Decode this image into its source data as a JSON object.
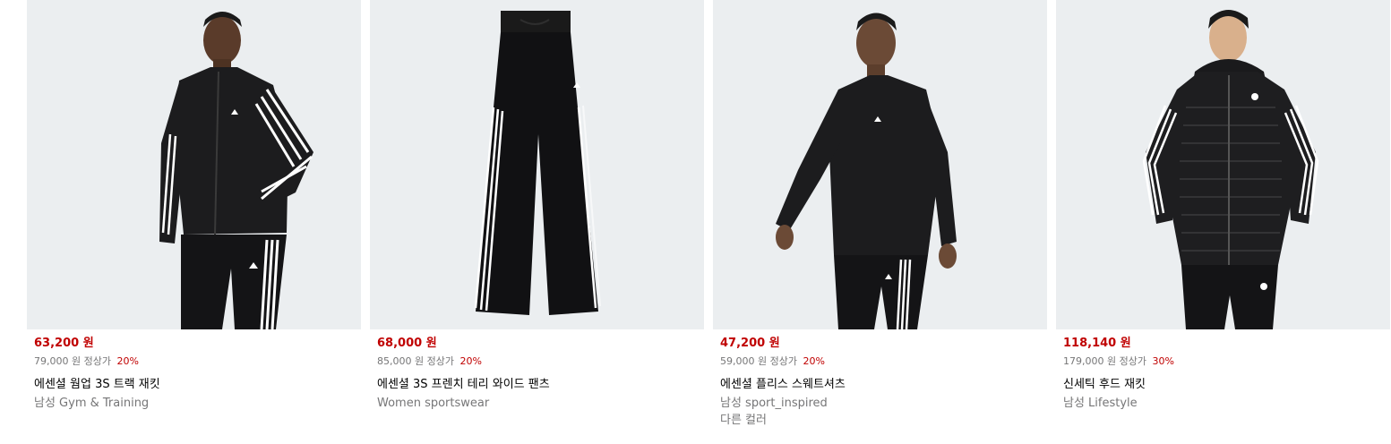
{
  "products": [
    {
      "price": "63,200 원",
      "original_price": "79,000 원",
      "original_label": "정상가",
      "discount": "20%",
      "name": "에센셜 웜업 3S 트랙 재킷",
      "category": "남성 Gym & Training",
      "colors_label": "",
      "image_icon": "track-jacket-model-image"
    },
    {
      "price": "68,000 원",
      "original_price": "85,000 원",
      "original_label": "정상가",
      "discount": "20%",
      "name": "에센셜 3S 프렌치 테리 와이드 팬츠",
      "category": "Women sportswear",
      "colors_label": "",
      "image_icon": "wide-pants-image"
    },
    {
      "price": "47,200 원",
      "original_price": "59,000 원",
      "original_label": "정상가",
      "discount": "20%",
      "name": "에센셜 플리스 스웨트셔츠",
      "category": "남성 sport_inspired",
      "colors_label": "다른 컬러",
      "image_icon": "sweatshirt-model-image"
    },
    {
      "price": "118,140 원",
      "original_price": "179,000 원",
      "original_label": "정상가",
      "discount": "30%",
      "name": "신세틱 후드 재킷",
      "category": "남성 Lifestyle",
      "colors_label": "",
      "image_icon": "puffer-jacket-model-image"
    }
  ],
  "colors": {
    "sale_red": "#c00000",
    "muted_gray": "#767677",
    "image_bg": "#ebeef0"
  }
}
